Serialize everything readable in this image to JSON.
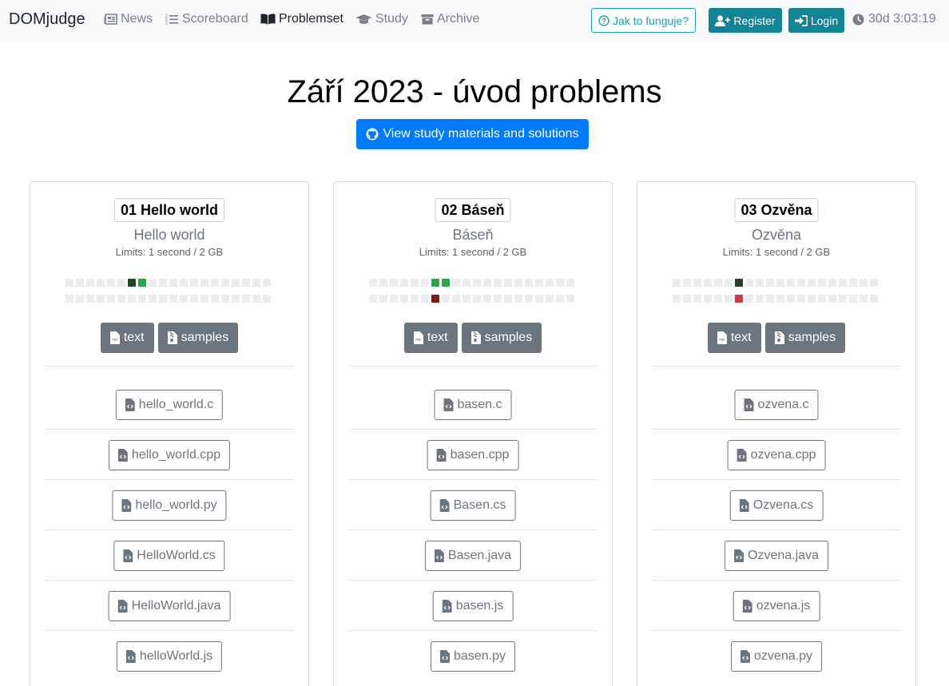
{
  "nav": {
    "brand": "DOMjudge",
    "items": [
      {
        "label": "News",
        "icon": "newspaper-icon",
        "active": false
      },
      {
        "label": "Scoreboard",
        "icon": "list-ol-icon",
        "active": false
      },
      {
        "label": "Problemset",
        "icon": "book-open-icon",
        "active": true
      },
      {
        "label": "Study",
        "icon": "graduation-cap-icon",
        "active": false
      },
      {
        "label": "Archive",
        "icon": "archive-icon",
        "active": false
      }
    ],
    "help_label": "Jak to funguje?",
    "register_label": "Register",
    "login_label": "Login",
    "clock": "30d 3:03:19"
  },
  "page": {
    "title": "Září 2023 - úvod problems",
    "study_button": "View study materials and solutions"
  },
  "colors": {
    "accent_teal": "#138496",
    "primary_blue": "#007bff",
    "solved_dark": "#1e4620",
    "solved_green": "#28a745",
    "wrong_dark": "#7a1a1a",
    "wrong_red": "#dc3545",
    "empty": "#ececec"
  },
  "problems": [
    {
      "badge": "01 Hello world",
      "name": "Hello world",
      "limits": "Limits: 1 second / 2 GB",
      "row1": {
        "6": "dark",
        "7": "green"
      },
      "row2": {},
      "text_label": "text",
      "samples_label": "samples",
      "files": [
        "hello_world.c",
        "hello_world.cpp",
        "hello_world.py",
        "HelloWorld.cs",
        "HelloWorld.java",
        "helloWorld.js"
      ]
    },
    {
      "badge": "02 Báseň",
      "name": "Báseň",
      "limits": "Limits: 1 second / 2 GB",
      "row1": {
        "6": "green",
        "7": "green"
      },
      "row2": {
        "6": "wrongdark"
      },
      "text_label": "text",
      "samples_label": "samples",
      "files": [
        "basen.c",
        "basen.cpp",
        "Basen.cs",
        "Basen.java",
        "basen.js",
        "basen.py"
      ]
    },
    {
      "badge": "03 Ozvěna",
      "name": "Ozvěna",
      "limits": "Limits: 1 second / 2 GB",
      "row1": {
        "6": "dark"
      },
      "row2": {
        "6": "wrongred"
      },
      "text_label": "text",
      "samples_label": "samples",
      "files": [
        "ozvena.c",
        "ozvena.cpp",
        "Ozvena.cs",
        "Ozvena.java",
        "ozvena.js",
        "ozvena.py"
      ]
    }
  ]
}
